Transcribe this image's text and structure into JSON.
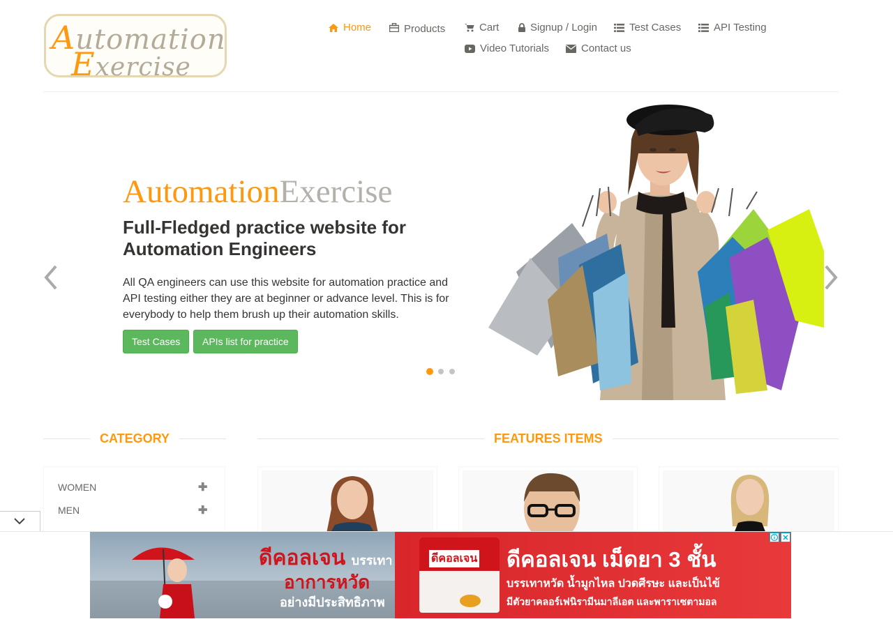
{
  "logo": {
    "line1_cap": "A",
    "line1_rest": "utomation",
    "line2_cap": "E",
    "line2_rest": "xercise"
  },
  "nav": [
    {
      "label": "Home",
      "icon": "home-icon",
      "active": true
    },
    {
      "label": "Products",
      "icon": "products-icon"
    },
    {
      "label": "Cart",
      "icon": "cart-icon"
    },
    {
      "label": "Signup / Login",
      "icon": "lock-icon"
    },
    {
      "label": "Test Cases",
      "icon": "list-icon"
    },
    {
      "label": "API Testing",
      "icon": "list-icon"
    },
    {
      "label": "Video Tutorials",
      "icon": "youtube-icon"
    },
    {
      "label": "Contact us",
      "icon": "envelope-icon"
    }
  ],
  "hero": {
    "brand_a": "Automation",
    "brand_b": "Exercise",
    "title": "Full-Fledged practice website for Automation Engineers",
    "text": "All QA engineers can use this website for automation practice and API testing either they are at beginner or advance level. This is for everybody to help them brush up their automation skills.",
    "btn_test_cases": "Test Cases",
    "btn_apis": "APIs list for practice",
    "active_slide": 1,
    "slide_count": 3
  },
  "sections": {
    "category": "CATEGORY",
    "features": "FEATURES ITEMS"
  },
  "categories": [
    {
      "label": "WOMEN"
    },
    {
      "label": "MEN"
    }
  ],
  "ad": {
    "left_brand": "ดีคอลเจน",
    "left_small": "บรรเทา",
    "left_line2": "อาการหวัด",
    "left_line3": "อย่างมีประสิทธิภาพ",
    "right_title": "ดีคอลเจน เม็ดยา 3 ชั้น",
    "right_line2": "บรรเทาหวัด น้ำมูกไหล ปวดศีรษะ และเป็นไข้",
    "right_line3": "มีตัวยาคลอร์เฟนิรามีนมาลีเอต และพาราเซตามอล",
    "pack_brand": "ดีคอลเจน"
  },
  "colors": {
    "accent": "#fe980f",
    "green": "#5cb85c",
    "text": "#696763",
    "dark": "#363432"
  }
}
